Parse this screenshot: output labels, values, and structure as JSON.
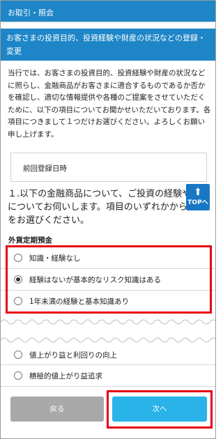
{
  "header": {
    "title": "お取引・照会"
  },
  "section": {
    "title": "お客さまの投資目的、投資経験や財産の状況などの登録・変更"
  },
  "intro": {
    "text": "当行では、お客さまの投資目的、投資経験や財産の状況などに照らし、金融商品がお客さまに適合するものであるか否かを確認し、適切な情報提供や各種のご提案をさせていただくために、以下の項目についてお聞かせいただいております。各項目につきまして１つだけお選びください。よろしくお願い申し上げます。"
  },
  "last_registered": {
    "label": "前回登録日時"
  },
  "question": {
    "text": "１.以下の金融商品について、ご投資の経験や知識についてお伺いします。項目のいずれかから１つをお選びください。"
  },
  "top_button": {
    "label": "TOPへ",
    "icon": "up-arrow-icon"
  },
  "product": {
    "name": "外貨定期預金"
  },
  "options_top": [
    {
      "label": "知識・経験なし",
      "selected": false
    },
    {
      "label": "経験はないが基本的なリスク知識はある",
      "selected": true
    },
    {
      "label": "1年未満の経験と基本知識あり",
      "selected": false
    }
  ],
  "options_bottom": [
    {
      "label": "値上がり益と利回りの向上",
      "selected": false
    },
    {
      "label": "積極的値上がり益追求",
      "selected": false
    }
  ],
  "buttons": {
    "back": "戻る",
    "next": "次へ"
  },
  "colors": {
    "brand_blue": "#1e86c7",
    "highlight_red": "#e60012",
    "next_button": "#29b3e8",
    "back_button": "#a9a9a9"
  }
}
